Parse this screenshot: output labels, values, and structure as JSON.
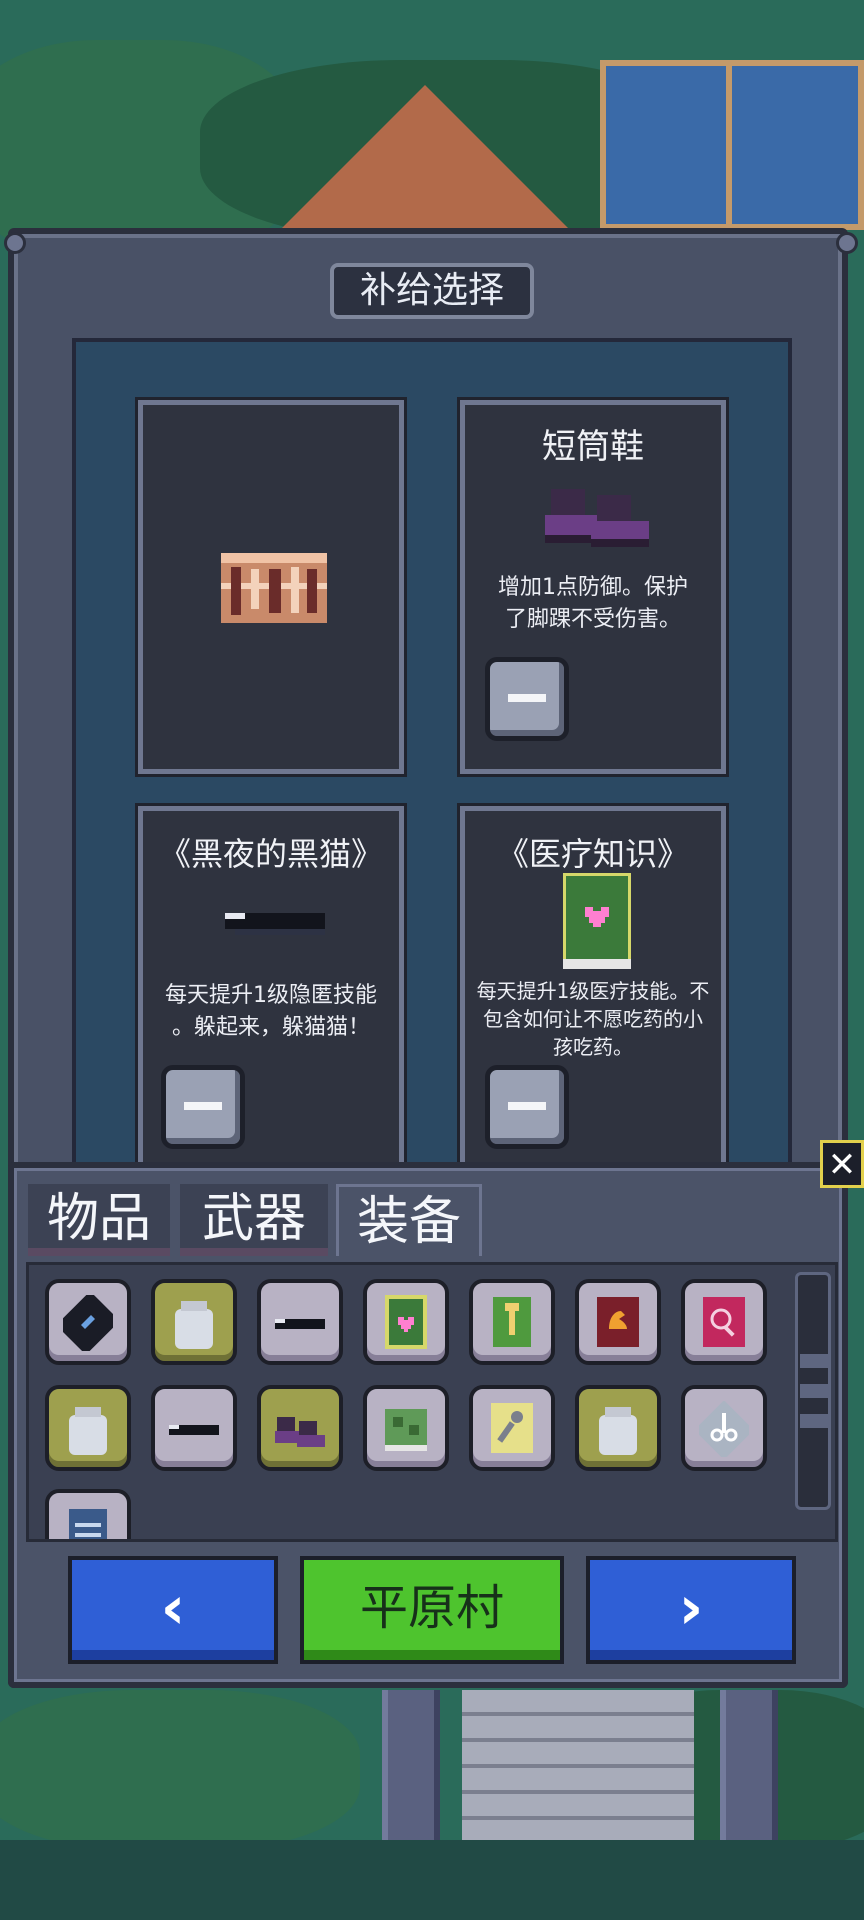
{
  "supply_panel": {
    "title": "补给选择",
    "cards": [
      {
        "title": "",
        "description": "",
        "icon": "treasure-chest-icon"
      },
      {
        "title": "短筒鞋",
        "description_line1": "增加1点防御。保护",
        "description_line2": "了脚踝不受伤害。",
        "icon": "boots-icon"
      },
      {
        "title": "《黑夜的黑猫》",
        "description_line1": "每天提升1级隐匿技能",
        "description_line2": "。躲起来，躲猫猫！",
        "icon": "black-bar-icon"
      },
      {
        "title": "《医疗知识》",
        "description_line1": "每天提升1级医疗技能。不",
        "description_line2": "包含如何让不愿吃药的小",
        "description_line3": "孩吃药。",
        "icon": "green-heart-book-icon"
      }
    ]
  },
  "inventory": {
    "tabs": [
      {
        "label": "物品"
      },
      {
        "label": "武器"
      },
      {
        "label": "装备"
      }
    ],
    "active_tab": "装备",
    "items": [
      "fish-book-icon",
      "glass-jar-icon",
      "black-bar-icon",
      "green-heart-book-icon",
      "key-book-icon",
      "strength-book-icon",
      "magnifier-book-icon",
      "glass-jar-icon",
      "black-bar-icon",
      "boots-icon",
      "green-book-icon",
      "wrench-book-icon",
      "glass-jar-icon",
      "scissors-book-icon",
      "blue-manual-icon"
    ]
  },
  "navigation": {
    "prev_label": "‹",
    "location": "平原村",
    "next_label": "›"
  },
  "close_label": "✕",
  "colors": {
    "blue": "#2f5fd6",
    "green": "#4ec42e",
    "panel": "#495166"
  }
}
